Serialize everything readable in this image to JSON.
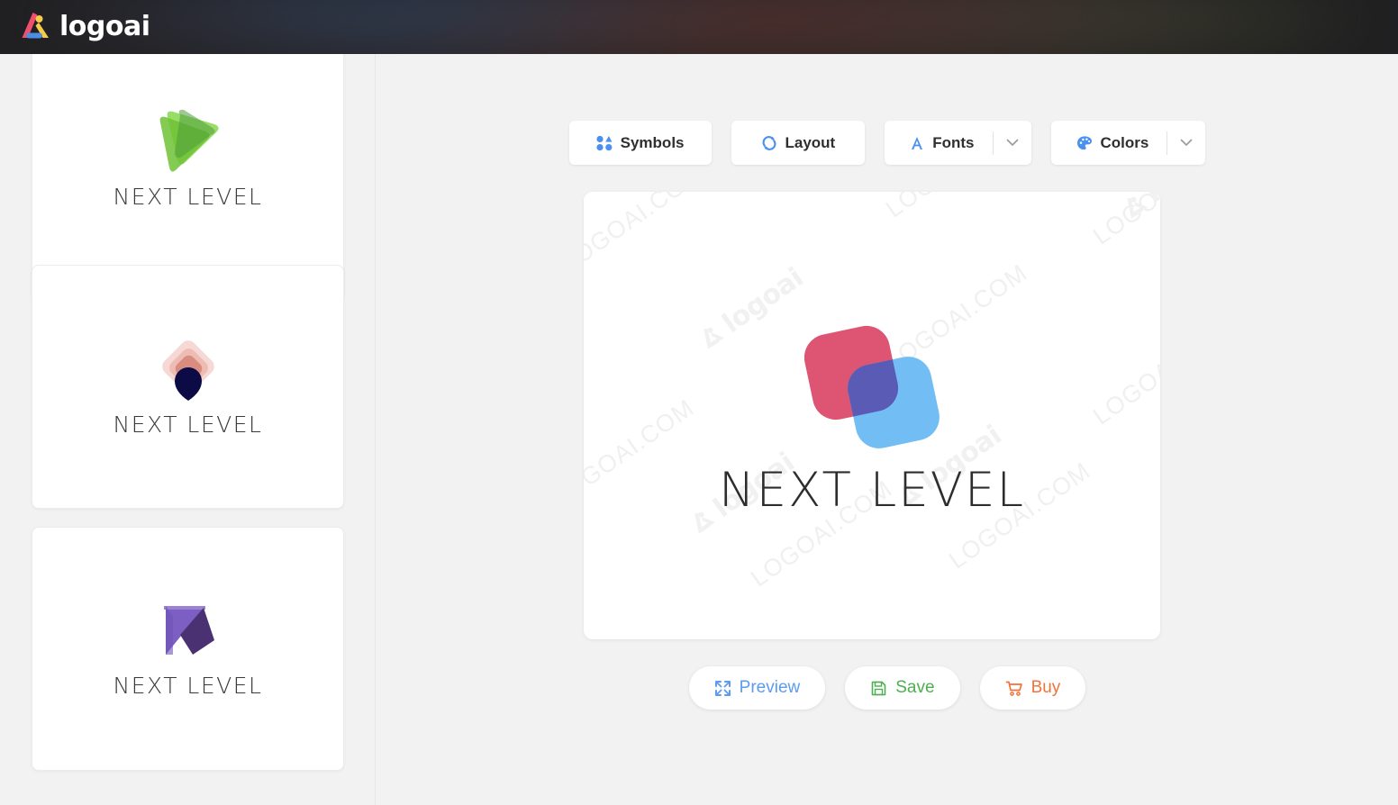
{
  "header": {
    "brand_name": "logoai",
    "brand_icon": "logoai-a-mark-icon",
    "colors": {
      "background": "#201f21",
      "mark_pink": "#f04f6e",
      "mark_yellow": "#f7cb4a",
      "mark_blue": "#4c8ee0"
    }
  },
  "sidebar": {
    "cards": [
      {
        "label": "NEXT LEVEL",
        "icon": "green-play-triangle-logo",
        "colors": {
          "light": "#8ed959",
          "mid": "#6fc236",
          "dark": "#4f9c3a"
        }
      },
      {
        "label": "NEXT LEVEL",
        "icon": "pink-diamond-navy-circle-logo",
        "colors": {
          "outer": "#f6d9d5",
          "mid": "#efbcb3",
          "inner": "#d98d80",
          "dot": "#0d0b45"
        }
      },
      {
        "label": "NEXT LEVEL",
        "icon": "purple-arrow-logo",
        "colors": {
          "light": "#7d5fc4",
          "dark": "#4a3272"
        }
      }
    ]
  },
  "toolbar": {
    "buttons": [
      {
        "label": "Symbols",
        "icon": "symbols-grid-icon",
        "has_dropdown": false
      },
      {
        "label": "Layout",
        "icon": "layout-refresh-icon",
        "has_dropdown": false
      },
      {
        "label": "Fonts",
        "icon": "font-a-icon",
        "has_dropdown": true
      },
      {
        "label": "Colors",
        "icon": "color-palette-icon",
        "has_dropdown": true
      }
    ],
    "icon_color": "#4a90f0",
    "caret_icon": "chevron-down-icon"
  },
  "canvas": {
    "logo_text": "NEXT LEVEL",
    "logo_icon": "overlapping-rounded-squares-logo",
    "colors": {
      "pink": "#dd5572",
      "blue": "#73bdf5",
      "overlap_purple": "#5a5bb5"
    },
    "watermarks": {
      "text": "LOGOAI.COM",
      "brand": "logoai",
      "color": "#f0f0f0"
    }
  },
  "actions": [
    {
      "label": "Preview",
      "icon": "expand-arrows-icon",
      "color": "#5b9cf0"
    },
    {
      "label": "Save",
      "icon": "floppy-disk-icon",
      "color": "#4caf50"
    },
    {
      "label": "Buy",
      "icon": "shopping-cart-icon",
      "color": "#f0733a"
    }
  ]
}
